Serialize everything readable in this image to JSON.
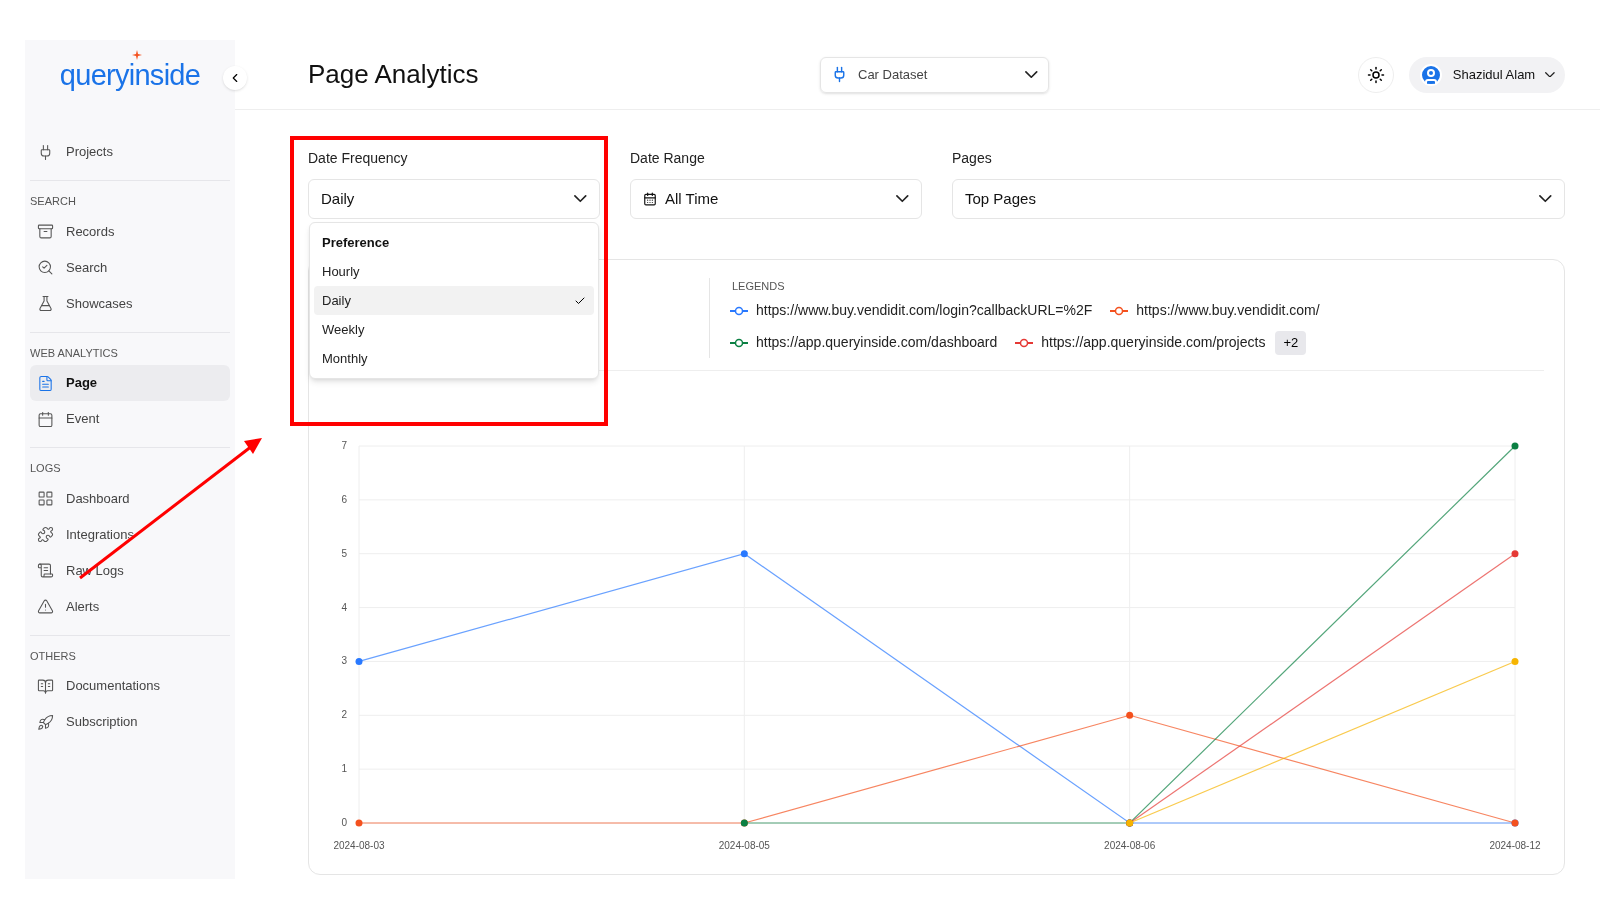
{
  "logo": {
    "text": "queryinside"
  },
  "sidebar": {
    "sections": [
      {
        "items": [
          {
            "label": "Projects",
            "selected": false
          }
        ]
      },
      {
        "heading": "SEARCH",
        "items": [
          {
            "label": "Records",
            "selected": false
          },
          {
            "label": "Search",
            "selected": false
          },
          {
            "label": "Showcases",
            "selected": false
          }
        ]
      },
      {
        "heading": "WEB ANALYTICS",
        "items": [
          {
            "label": "Page",
            "selected": true
          },
          {
            "label": "Event",
            "selected": false
          }
        ]
      },
      {
        "heading": "LOGS",
        "items": [
          {
            "label": "Dashboard",
            "selected": false
          },
          {
            "label": "Integrations",
            "selected": false
          },
          {
            "label": "Raw Logs",
            "selected": false
          },
          {
            "label": "Alerts",
            "selected": false
          }
        ]
      },
      {
        "heading": "OTHERS",
        "items": [
          {
            "label": "Documentations",
            "selected": false
          },
          {
            "label": "Subscription",
            "selected": false
          }
        ]
      }
    ]
  },
  "header": {
    "title": "Page Analytics",
    "dataset": "Car Dataset",
    "user": "Shazidul Alam"
  },
  "filters": [
    {
      "label": "Date Frequency",
      "value": "Daily",
      "kind": "select"
    },
    {
      "label": "Date Range",
      "value": "All Time",
      "kind": "date"
    },
    {
      "label": "Pages",
      "value": "Top Pages",
      "kind": "select"
    }
  ],
  "frequency_menu": {
    "heading": "Preference",
    "options": [
      {
        "label": "Hourly",
        "selected": false
      },
      {
        "label": "Daily",
        "selected": true
      },
      {
        "label": "Weekly",
        "selected": false
      },
      {
        "label": "Monthly",
        "selected": false
      }
    ]
  },
  "legend": {
    "title": "LEGENDS",
    "more": "+2"
  },
  "chart_data": {
    "type": "line",
    "grid": true,
    "categories": [
      "2024-08-03",
      "2024-08-05",
      "2024-08-06",
      "2024-08-12"
    ],
    "ylim": [
      0,
      7
    ],
    "yticks": [
      0,
      1,
      2,
      3,
      4,
      5,
      6,
      7
    ],
    "series": [
      {
        "name": "https://www.buy.vendidit.com/login?callbackURL=%2F",
        "color": "#2979ff",
        "marker": "circle",
        "values": [
          3,
          5,
          0,
          0
        ]
      },
      {
        "name": "https://www.buy.vendidit.com/",
        "color": "#f4511e",
        "marker": "circle",
        "values": [
          0,
          0,
          2,
          0
        ]
      },
      {
        "name": "https://app.queryinside.com/dashboard",
        "color": "#0b8043",
        "marker": "circle",
        "values": [
          null,
          0,
          0,
          7
        ]
      },
      {
        "name": "https://app.queryinside.com/projects",
        "color": "#e53935",
        "marker": "circle",
        "values": [
          null,
          null,
          0,
          5
        ]
      },
      {
        "color": "#f6b400",
        "marker": "circle",
        "values": [
          null,
          null,
          0,
          3
        ]
      }
    ]
  }
}
